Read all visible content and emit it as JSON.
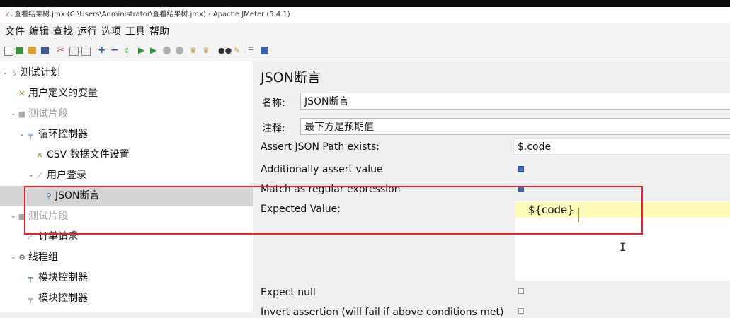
{
  "window": {
    "title": "查看结果树.jmx (C:\\Users\\Administrator\\查看结果树.jmx) - Apache JMeter (5.4.1)"
  },
  "menu": [
    "文件",
    "编辑",
    "查找",
    "运行",
    "选项",
    "工具",
    "帮助"
  ],
  "tree": [
    {
      "label": "测试计划",
      "icon": "flask-icon",
      "expanded": true
    },
    {
      "label": "用户定义的变量",
      "icon": "wrench-icon"
    },
    {
      "label": "测试片段",
      "icon": "fragment-icon",
      "expanded": true
    },
    {
      "label": "循环控制器",
      "icon": "controller-icon",
      "expanded": true
    },
    {
      "label": "CSV 数据文件设置",
      "icon": "wrench-icon"
    },
    {
      "label": "用户登录",
      "icon": "pen-icon",
      "expanded": true
    },
    {
      "label": "JSON断言",
      "icon": "magnifier-icon",
      "selected": true
    },
    {
      "label": "测试片段",
      "icon": "fragment-icon",
      "expanded": true
    },
    {
      "label": "订单请求",
      "icon": "pen-icon"
    },
    {
      "label": "线程组",
      "icon": "gear-icon",
      "expanded": true
    },
    {
      "label": "模块控制器",
      "icon": "controller-icon"
    },
    {
      "label": "模块控制器",
      "icon": "controller-icon"
    }
  ],
  "panel": {
    "title": "JSON断言",
    "name_label": "名称:",
    "name_value": "JSON断言",
    "comment_label": "注释:",
    "comment_value": "最下方是预期值",
    "path_label": "Assert JSON Path exists:",
    "path_value": "$.code",
    "additionally_label": "Additionally assert value",
    "additionally_checked": true,
    "regex_label": "Match as regular expression",
    "regex_checked": true,
    "expected_label": "Expected Value:",
    "expected_value": "${code}",
    "expect_null_label": "Expect null",
    "expect_null_checked": false,
    "invert_label": "Invert assertion (will fail if above conditions met)",
    "invert_checked": false
  },
  "colors": {
    "highlight_box": "#e0262b",
    "selected_row": "#d4d4d4",
    "checkbox_on": "#3d6fc4",
    "expected_line": "#fffbb8"
  }
}
